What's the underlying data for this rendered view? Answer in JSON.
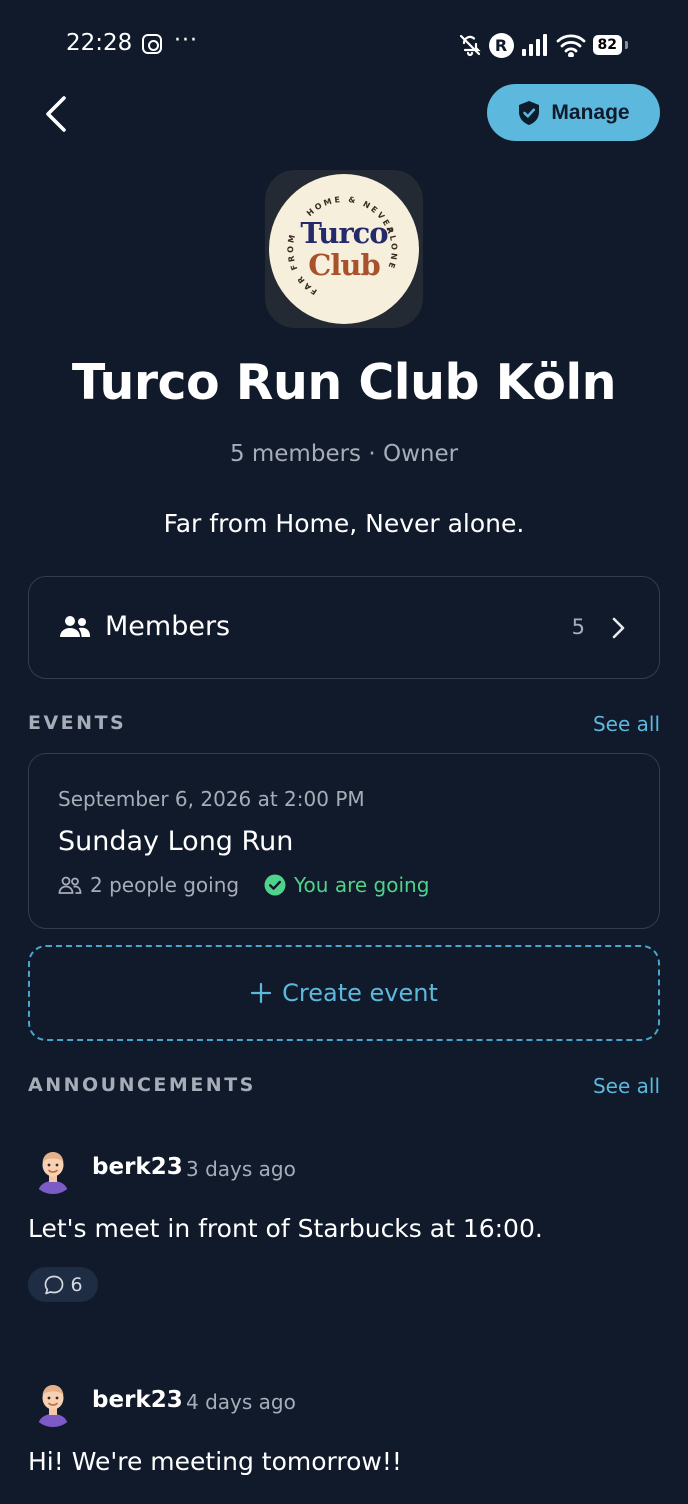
{
  "status_bar": {
    "time": "22:28",
    "more": "···",
    "r_badge": "R",
    "battery": "82"
  },
  "header": {
    "manage_label": "Manage"
  },
  "club": {
    "logo_top_text": "HOME & NEVER",
    "logo_left_text": "FAR FROM",
    "logo_right_text": "ALONE",
    "logo_line1": "Turco",
    "logo_line2": "Club",
    "name": "Turco Run Club Köln",
    "meta": "5 members · Owner",
    "tagline": "Far from Home, Never alone."
  },
  "members": {
    "label": "Members",
    "count": "5"
  },
  "events": {
    "section_title": "EVENTS",
    "see_all": "See all",
    "items": [
      {
        "date": "September 6, 2026 at 2:00 PM",
        "title": "Sunday Long Run",
        "people": "2 people going",
        "status": "You are going"
      }
    ],
    "create_label": "Create event"
  },
  "announcements": {
    "section_title": "ANNOUNCEMENTS",
    "see_all": "See all",
    "items": [
      {
        "author": "berk23",
        "time": "3 days ago",
        "text": "Let's meet in front of Starbucks at 16:00.",
        "comments": "6"
      },
      {
        "author": "berk23",
        "time": "4 days ago",
        "text": "Hi! We're meeting tomorrow!!"
      }
    ]
  },
  "colors": {
    "background": "#101a2a",
    "accent": "#5cb8dd",
    "success": "#4fd28a",
    "card_border": "#323c4f"
  }
}
